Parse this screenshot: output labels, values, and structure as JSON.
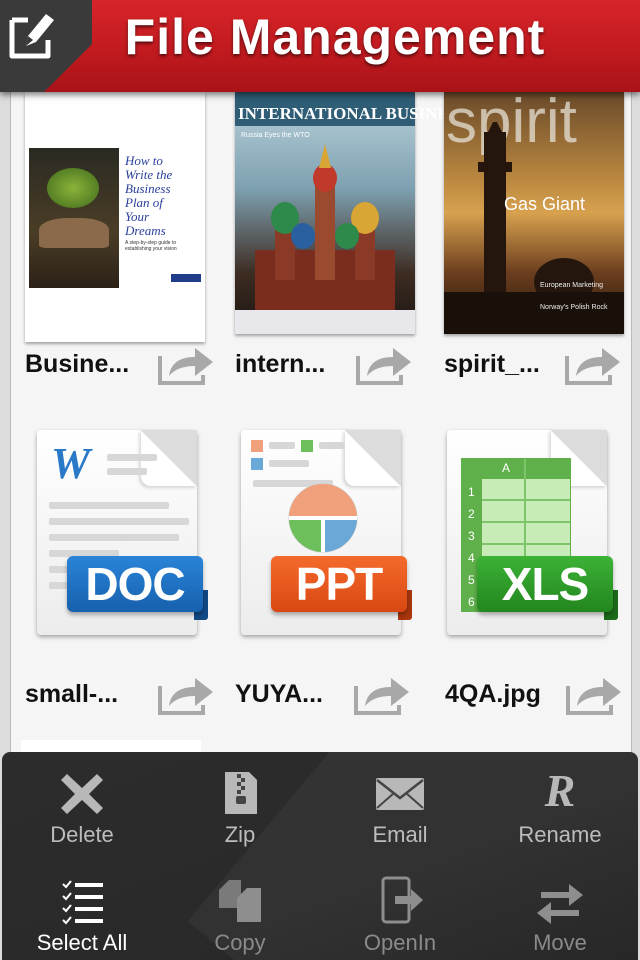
{
  "header": {
    "title": "File Management",
    "edit_icon": "edit-pencil-icon"
  },
  "files": [
    {
      "name": "Busine...",
      "type": "pdf-cover",
      "cover": {
        "title_lines": [
          "How to",
          "Write the",
          "Business",
          "Plan of",
          "Your",
          "Dreams"
        ],
        "subtitle": "A step-by-step guide to establishing your vision"
      }
    },
    {
      "name": "intern...",
      "type": "magazine",
      "cover": {
        "masthead": "INTERNATIONAL BUSINESS",
        "tagline": "Russia Eyes the WTO"
      }
    },
    {
      "name": "spirit_...",
      "type": "magazine",
      "cover": {
        "masthead": "spirit",
        "headline": "Gas Giant",
        "blurb1": "European Marketing",
        "blurb2": "Norway's Polish Rock"
      }
    },
    {
      "name": "small-...",
      "type": "doc",
      "badge": "DOC",
      "badge_color": "#1e6fbf",
      "letter": "W"
    },
    {
      "name": "YUYA...",
      "type": "ppt",
      "badge": "PPT",
      "badge_color": "#e8541a"
    },
    {
      "name": "4QA.jpg",
      "type": "xls",
      "badge": "XLS",
      "badge_color": "#2e9a2a",
      "column": "A",
      "rows": [
        "1",
        "2",
        "3",
        "4",
        "5",
        "6"
      ]
    }
  ],
  "toolbar": {
    "items": [
      {
        "label": "Delete",
        "icon": "delete-x-icon"
      },
      {
        "label": "Zip",
        "icon": "zip-icon"
      },
      {
        "label": "Email",
        "icon": "envelope-icon"
      },
      {
        "label": "Rename",
        "icon": "rename-r-icon",
        "glyph": "R"
      },
      {
        "label": "Select All",
        "icon": "checklist-icon"
      },
      {
        "label": "Copy",
        "icon": "copy-icon"
      },
      {
        "label": "OpenIn",
        "icon": "open-in-icon"
      },
      {
        "label": "Move",
        "icon": "move-arrows-icon"
      }
    ]
  },
  "colors": {
    "header_red": "#c11a1f",
    "toolbar_bg": "#2a2a2a",
    "doc_blue": "#1e6fbf",
    "ppt_orange": "#e8541a",
    "xls_green": "#2e9a2a"
  }
}
